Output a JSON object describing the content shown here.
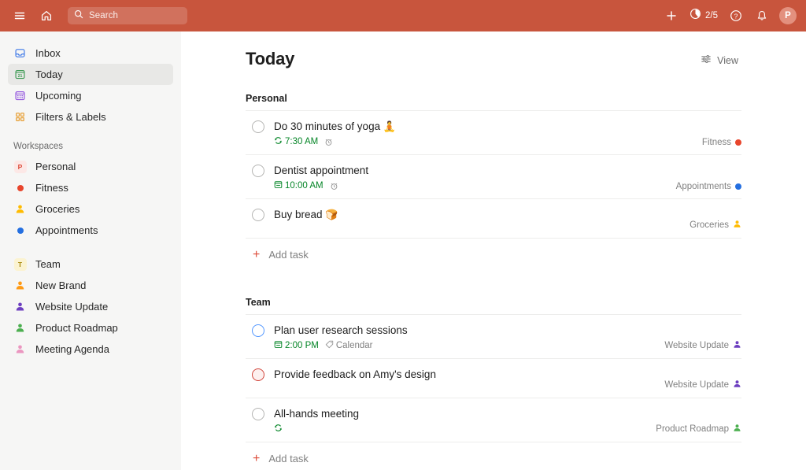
{
  "colors": {
    "header_bg": "#c8553d",
    "sidebar_bg": "#f6f6f5",
    "accent_red": "#dd4b39",
    "date_green": "#058527",
    "priority_blue": "#5297ff",
    "priority_red": "#d1453b"
  },
  "header": {
    "menu_icon": "hamburger-menu-icon",
    "home_icon": "home-icon",
    "search": {
      "placeholder": "Search",
      "value": "",
      "icon": "search-icon"
    },
    "add_icon": "plus-icon",
    "productivity": {
      "label": "2/5",
      "icon": "productivity-pie-icon"
    },
    "help_icon": "help-question-icon",
    "notifications_icon": "bell-icon",
    "avatar": {
      "initial": "P",
      "name": "avatar"
    }
  },
  "sidebar": {
    "nav": [
      {
        "label": "Inbox",
        "icon": "inbox-icon",
        "active": false
      },
      {
        "label": "Today",
        "icon": "today-calendar-icon",
        "active": true
      },
      {
        "label": "Upcoming",
        "icon": "upcoming-calendar-icon",
        "active": false
      },
      {
        "label": "Filters & Labels",
        "icon": "filters-labels-icon",
        "active": false
      }
    ],
    "workspaces_title": "Workspaces",
    "workspaces": [
      {
        "label": "Personal",
        "icon": "workspace-badge",
        "badge": "P",
        "badge_bg": "#fce8e6",
        "badge_fg": "#dd4b39"
      },
      {
        "label": "Fitness",
        "icon": "project-dot",
        "color": "#e8452c"
      },
      {
        "label": "Groceries",
        "icon": "shared-project-person-icon",
        "color": "#ffbb00"
      },
      {
        "label": "Appointments",
        "icon": "project-dot",
        "color": "#246fe0"
      }
    ],
    "team": [
      {
        "label": "Team",
        "icon": "workspace-badge",
        "badge": "T",
        "badge_bg": "#fbf3d1",
        "badge_fg": "#a8880a"
      },
      {
        "label": "New Brand",
        "icon": "shared-project-person-icon",
        "color": "#ff9a14"
      },
      {
        "label": "Website Update",
        "icon": "shared-project-person-icon",
        "color": "#6d3fc0"
      },
      {
        "label": "Product Roadmap",
        "icon": "shared-project-person-icon",
        "color": "#4caf50"
      },
      {
        "label": "Meeting Agenda",
        "icon": "shared-project-person-icon",
        "color": "#eb96c0"
      }
    ]
  },
  "main": {
    "title": "Today",
    "view_button": {
      "label": "View",
      "icon": "sliders-icon"
    },
    "add_task_label": "Add task",
    "groups": [
      {
        "name": "Personal",
        "tasks": [
          {
            "title": "Do 30 minutes of yoga",
            "emoji": "🧘",
            "priority": "none",
            "date": "7:30 AM",
            "date_icon": "recurring-icon",
            "reminder_icon": "alarm-clock-icon",
            "label": "",
            "project": "Fitness",
            "project_icon": "project-dot",
            "project_color": "#e8452c"
          },
          {
            "title": "Dentist appointment",
            "emoji": "",
            "priority": "none",
            "date": "10:00 AM",
            "date_icon": "calendar-icon",
            "reminder_icon": "alarm-clock-icon",
            "label": "",
            "project": "Appointments",
            "project_icon": "project-dot",
            "project_color": "#246fe0"
          },
          {
            "title": "Buy bread",
            "emoji": "🍞",
            "priority": "none",
            "date": "",
            "date_icon": "",
            "reminder_icon": "",
            "label": "",
            "project": "Groceries",
            "project_icon": "shared-project-person-icon",
            "project_color": "#ffbb00"
          }
        ]
      },
      {
        "name": "Team",
        "tasks": [
          {
            "title": "Plan user research sessions",
            "emoji": "",
            "priority": "p2",
            "date": "2:00 PM",
            "date_icon": "calendar-icon",
            "reminder_icon": "",
            "label": "Calendar",
            "project": "Website Update",
            "project_icon": "shared-project-person-icon",
            "project_color": "#6d3fc0"
          },
          {
            "title": "Provide feedback on Amy's design",
            "emoji": "",
            "priority": "p1",
            "date": "",
            "date_icon": "",
            "reminder_icon": "",
            "label": "",
            "project": "Website Update",
            "project_icon": "shared-project-person-icon",
            "project_color": "#6d3fc0"
          },
          {
            "title": "All-hands meeting",
            "emoji": "",
            "priority": "none",
            "date": "",
            "date_icon": "recurring-icon",
            "reminder_icon": "",
            "label": "",
            "project": "Product Roadmap",
            "project_icon": "shared-project-person-icon",
            "project_color": "#4caf50"
          }
        ]
      }
    ]
  }
}
